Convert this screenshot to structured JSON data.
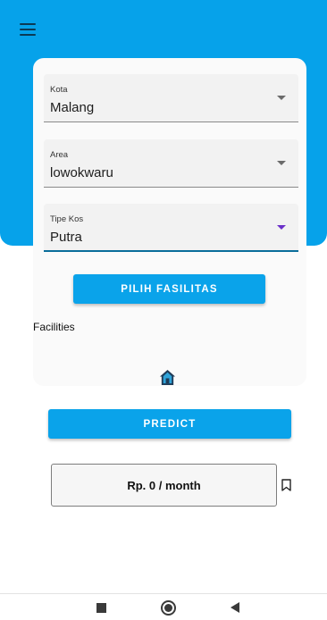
{
  "form": {
    "kota": {
      "label": "Kota",
      "value": "Malang"
    },
    "area": {
      "label": "Area",
      "value": "lowokwaru"
    },
    "tipe_kos": {
      "label": "Tipe Kos",
      "value": "Putra"
    },
    "pilih_fasilitas_label": "PILIH FASILITAS",
    "facilities_label": "Facilities",
    "facility_icon": "house-icon"
  },
  "predict_label": "PREDICT",
  "result": {
    "text": "Rp. 0 / month",
    "bookmark_icon": "bookmark-icon"
  },
  "navbar": {
    "recents_icon": "square-icon",
    "home_icon": "circle-icon",
    "back_icon": "triangle-back-icon"
  },
  "colors": {
    "primary": "#06a2ea",
    "button": "#0aa3ea",
    "accent_caret": "#6a2fc9"
  }
}
